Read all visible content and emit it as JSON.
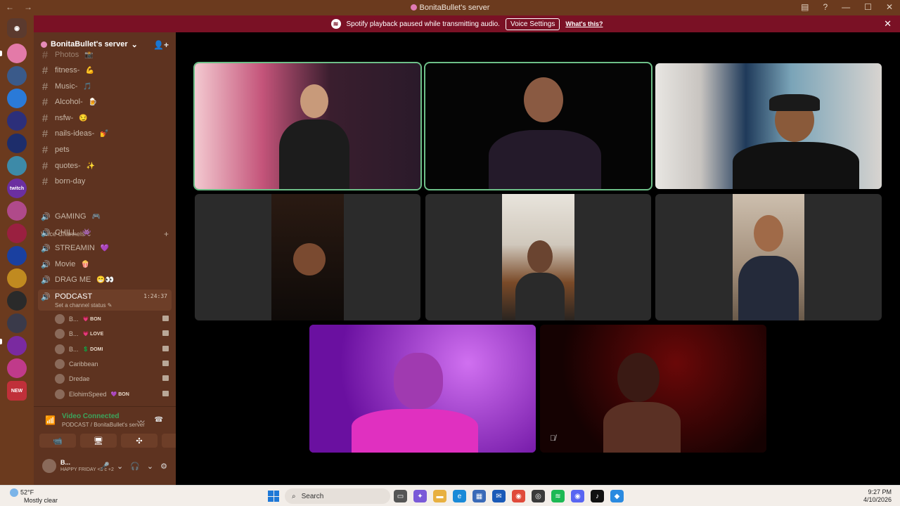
{
  "window": {
    "title": "BonitaBullet's server",
    "back": "←",
    "forward": "→",
    "controls": [
      "▤",
      "?",
      "—",
      "☐",
      "✕"
    ]
  },
  "banner": {
    "message": "Spotify playback paused while transmitting audio.",
    "button": "Voice Settings",
    "link": "What's this?",
    "close": "✕"
  },
  "server": {
    "name": "BonitaBullet's server",
    "chevron": "⌄",
    "add_member": "👤+"
  },
  "rail": {
    "new_badge": "NEW"
  },
  "text_channels": [
    {
      "name": "Photos",
      "emoji": "📸"
    },
    {
      "name": "fitness-",
      "emoji": "💪"
    },
    {
      "name": "Music-",
      "emoji": "🎵"
    },
    {
      "name": "Alcohol-",
      "emoji": "🍺"
    },
    {
      "name": "nsfw-",
      "emoji": "😏"
    },
    {
      "name": "nails-ideas-",
      "emoji": "💅"
    },
    {
      "name": "pets",
      "emoji": ""
    },
    {
      "name": "quotes-",
      "emoji": "✨"
    },
    {
      "name": "born-day",
      "emoji": ""
    }
  ],
  "voice_category": {
    "label": "Voice Channels",
    "chevron": "⌄",
    "plus": "+"
  },
  "voice_channels": [
    {
      "name": "GAMING",
      "emoji": "🎮"
    },
    {
      "name": "CHILL",
      "emoji": "👾"
    },
    {
      "name": "STREAMIN",
      "emoji": "💜"
    },
    {
      "name": "Movie",
      "emoji": "🍿"
    },
    {
      "name": "DRAG ME",
      "emoji": "😁👀"
    }
  ],
  "podcast": {
    "name": "PODCAST",
    "status": "Set a channel status ✎",
    "timer": "1:24:37",
    "members": [
      {
        "name": "B...",
        "tag": "💗 BON"
      },
      {
        "name": "B...",
        "tag": "💗 LOVE"
      },
      {
        "name": "B...",
        "tag": "💲 DOMI"
      },
      {
        "name": "Caribbean",
        "tag": ""
      },
      {
        "name": "Dredae",
        "tag": ""
      },
      {
        "name": "ElohimSpeed",
        "tag": "💜 BON"
      }
    ]
  },
  "voice_connected": {
    "title": "Video Connected",
    "subtitle": "PODCAST / BonitaBullet's server",
    "signal": "📶",
    "wave": "〰",
    "disconnect": "☎",
    "buttons": [
      "📹",
      "🖥",
      "✣",
      "🚀"
    ]
  },
  "user": {
    "name": "B...",
    "status": "HAPPY FRIDAY <3 c +2",
    "controls": [
      "🎤",
      "⌄",
      "🎧",
      "⌄",
      "⚙"
    ]
  },
  "taskbar": {
    "temp": "52°F",
    "weather": "Mostly clear",
    "search": "Search",
    "time": "9:27 PM",
    "date": "4/10/2026"
  },
  "colors": {
    "titlebar": "#6b3a1e",
    "sidebar": "#5e3320",
    "banner": "#7a1125",
    "speaking": "#6dbf88",
    "connected": "#3ba55c"
  }
}
